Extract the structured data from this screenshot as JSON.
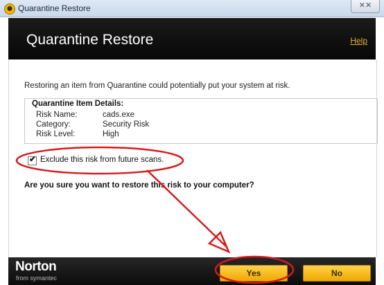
{
  "window": {
    "title": "Quarantine Restore",
    "close_glyph": "x̲x̲"
  },
  "header": {
    "title": "Quarantine Restore",
    "help_label": "Help"
  },
  "body": {
    "warning_text": "Restoring an item from Quarantine could potentially put your system at risk.",
    "details": {
      "heading": "Quarantine Item Details:",
      "rows": [
        {
          "label": "Risk Name:",
          "value": "cads.exe"
        },
        {
          "label": "Category:",
          "value": "Security Risk"
        },
        {
          "label": "Risk Level:",
          "value": "High"
        }
      ]
    },
    "exclude_checkbox": {
      "label": "Exclude this risk from future scans.",
      "checked": true
    },
    "question": "Are you sure you want to restore this risk to your computer?"
  },
  "footer": {
    "brand": "Norton",
    "brand_sub": "from symantec",
    "yes_label": "Yes",
    "no_label": "No"
  },
  "colors": {
    "header_bg": "#0d0d0d",
    "button_yellow": "#f7c21d",
    "help_link": "#e3b23c",
    "annotation_red": "#d6191c"
  }
}
